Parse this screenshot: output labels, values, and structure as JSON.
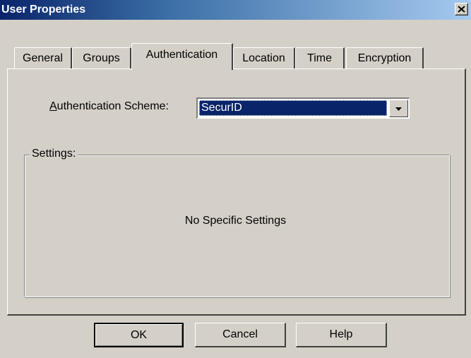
{
  "window": {
    "title": "User Properties"
  },
  "tabs": [
    {
      "label": "General",
      "active": false
    },
    {
      "label": "Groups",
      "active": false
    },
    {
      "label": "Authentication",
      "active": true
    },
    {
      "label": "Location",
      "active": false
    },
    {
      "label": "Time",
      "active": false
    },
    {
      "label": "Encryption",
      "active": false
    }
  ],
  "auth": {
    "label_accel": "A",
    "label_rest": "uthentication Scheme:",
    "selected_value": "SecurID"
  },
  "settings": {
    "group_title": "Settings:",
    "message": "No Specific Settings"
  },
  "buttons": {
    "ok": "OK",
    "cancel": "Cancel",
    "help": "Help"
  },
  "colors": {
    "title_bar_start": "#0a246a",
    "title_bar_end": "#a6caf0",
    "dialog_face": "#d4d0c8",
    "selection": "#0a246a"
  },
  "icons": {
    "close": "close-icon",
    "dropdown": "chevron-down-icon"
  }
}
